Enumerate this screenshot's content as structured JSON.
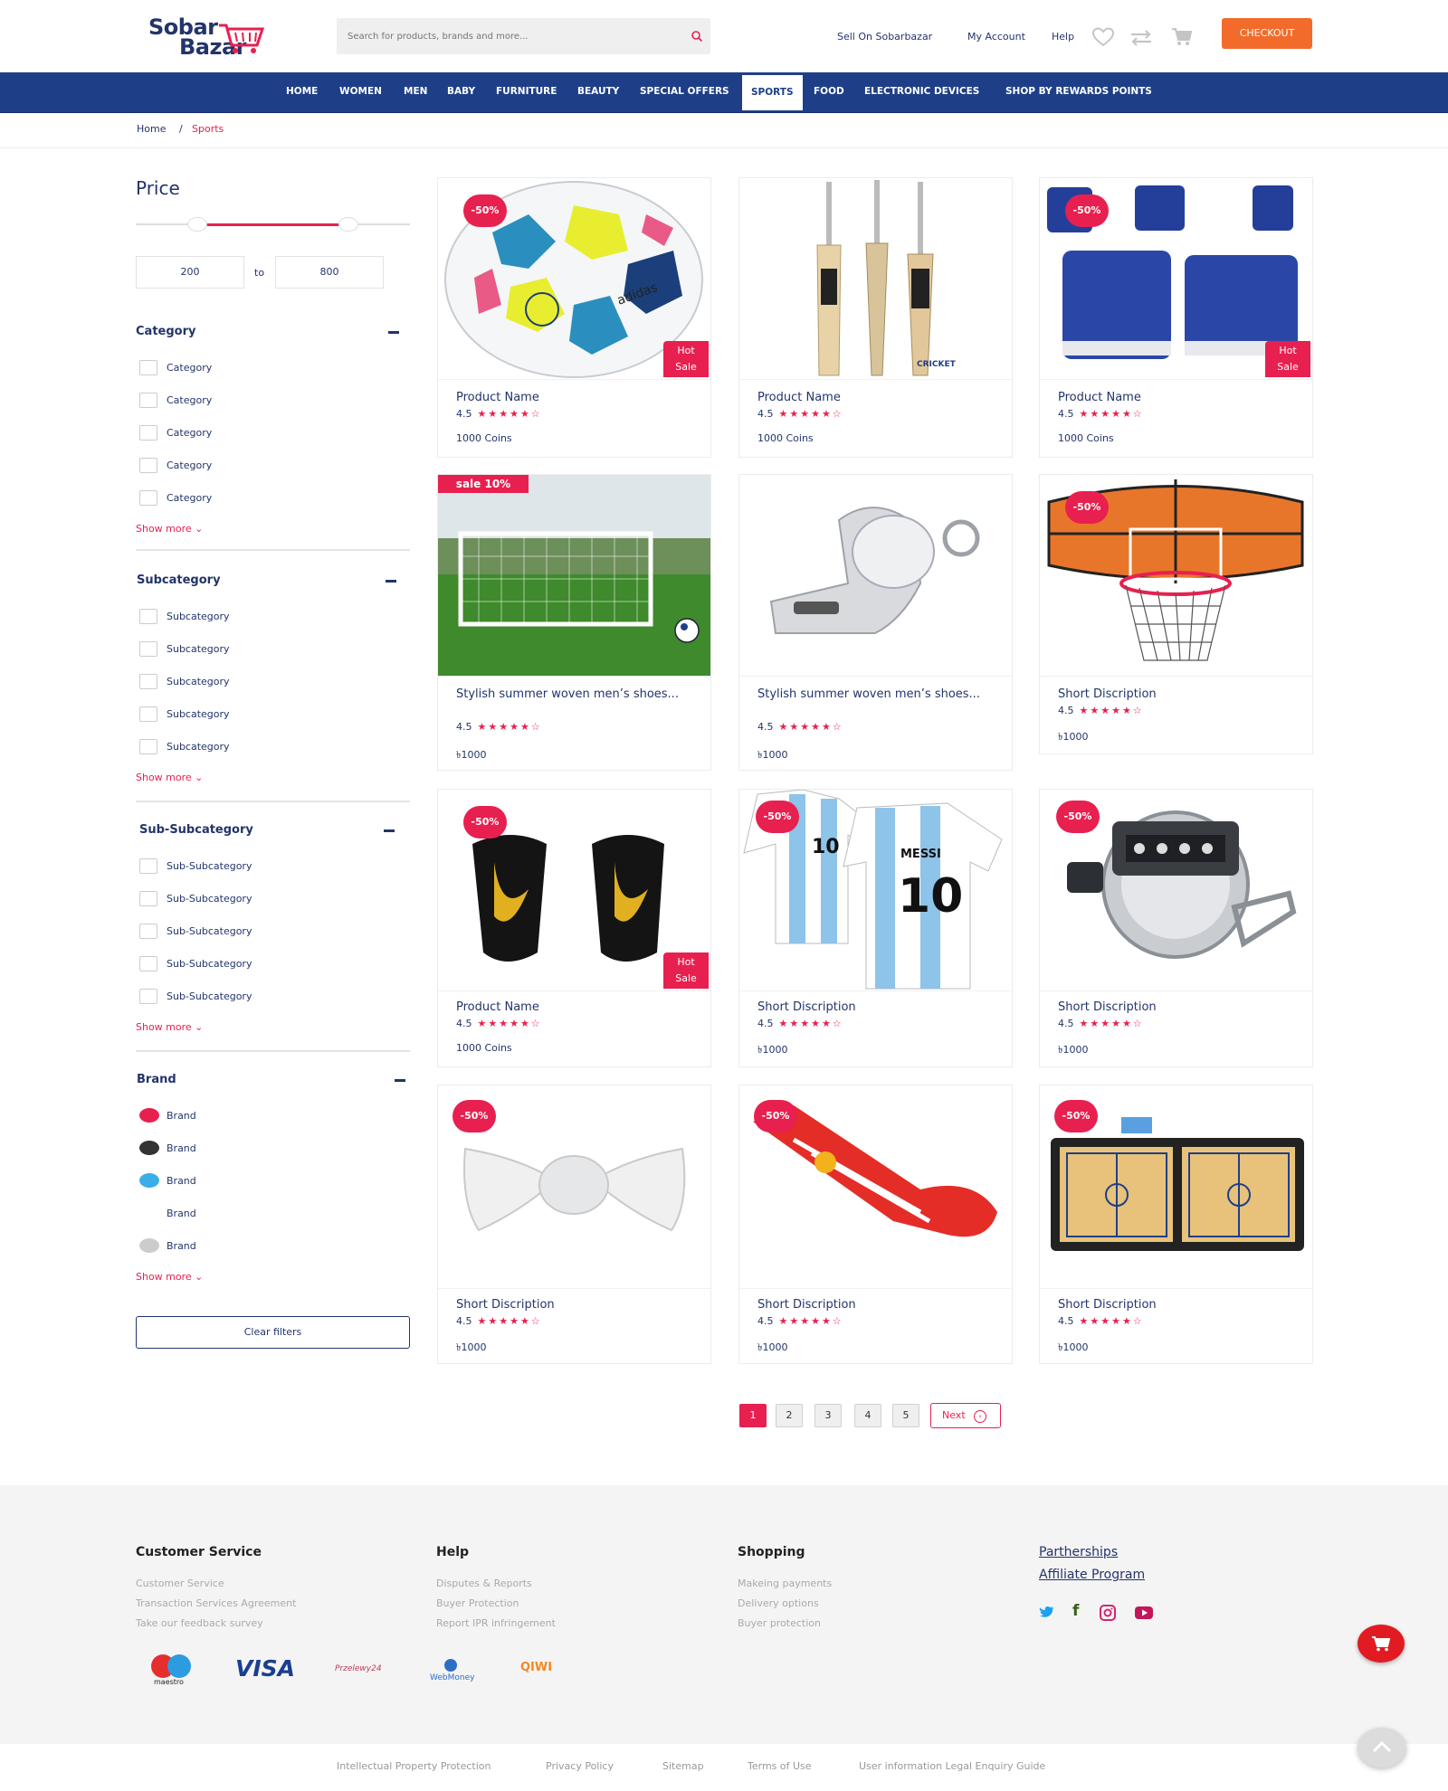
{
  "header": {
    "logo_line1": "Sobar",
    "logo_line2": "Bazar",
    "search_placeholder": "Search for products, brands and more...",
    "links": [
      "Sell On Sobarbazar",
      "My Account",
      "Help"
    ],
    "checkout_label": "CHECKOUT",
    "accent": "#f26b2b"
  },
  "nav": {
    "items": [
      "HOME",
      "WOMEN",
      "MEN",
      "BABY",
      "FURNITURE",
      "BEAUTY",
      "SPECIAL OFFERS",
      "SPORTS",
      "FOOD",
      "ELECTRONIC DEVICES",
      "SHOP BY REWARDS POINTS"
    ],
    "active": "SPORTS",
    "color": "#1e3f88"
  },
  "breadcrumb": {
    "home": "Home",
    "sep": "/",
    "current": "Sports"
  },
  "sidebar": {
    "price": {
      "title": "Price",
      "min": "200",
      "to": "to",
      "max": "800"
    },
    "category": {
      "title": "Category",
      "items": [
        "Category",
        "Category",
        "Category",
        "Category",
        "Category"
      ],
      "show_more": "Show more"
    },
    "subcategory": {
      "title": "Subcategory",
      "items": [
        "Subcategory",
        "Subcategory",
        "Subcategory",
        "Subcategory",
        "Subcategory"
      ],
      "show_more": "Show more"
    },
    "subsubcategory": {
      "title": "Sub-Subcategory",
      "items": [
        "Sub-Subcategory",
        "Sub-Subcategory",
        "Sub-Subcategory",
        "Sub-Subcategory",
        "Sub-Subcategory"
      ],
      "show_more": "Show more"
    },
    "brand": {
      "title": "Brand",
      "items": [
        {
          "label": "Brand",
          "color": "#e8204f"
        },
        {
          "label": "Brand",
          "color": "#333333"
        },
        {
          "label": "Brand",
          "color": "#3aaee8"
        },
        {
          "label": "Brand",
          "color": "#ffffff"
        },
        {
          "label": "Brand",
          "color": "#cccccc"
        }
      ],
      "show_more": "Show more"
    },
    "clear_filters": "Clear filters"
  },
  "products": [
    {
      "name": "Product Name",
      "rating": "4.5",
      "stars": "★★★★★☆",
      "price": "1000 Coins",
      "discount": "-50%",
      "hot": [
        "Hot",
        "Sale"
      ],
      "image": "soccer-ball"
    },
    {
      "name": "Product Name",
      "rating": "4.5",
      "stars": "★★★★★☆",
      "price": "1000 Coins",
      "image": "cricket-bats"
    },
    {
      "name": "Product Name",
      "rating": "4.5",
      "stars": "★★★★★☆",
      "price": "1000 Coins",
      "discount": "-50%",
      "hot": [
        "Hot",
        "Sale"
      ],
      "image": "ankle-supports"
    },
    {
      "name": "Stylish summer woven men’s shoes...",
      "rating": "4.5",
      "stars": "★★★★★☆",
      "price": "৳1000",
      "sale": "sale 10%",
      "image": "soccer-goal"
    },
    {
      "name": "Stylish summer woven men’s shoes...",
      "rating": "4.5",
      "stars": "★★★★★☆",
      "price": "৳1000",
      "image": "whistle"
    },
    {
      "name": "Short Discription",
      "rating": "4.5",
      "stars": "★★★★★☆",
      "price": "৳1000",
      "discount": "-50%",
      "image": "basketball-hoop"
    },
    {
      "name": "Product Name",
      "rating": "4.5",
      "stars": "★★★★★☆",
      "price": "1000 Coins",
      "discount": "-50%",
      "hot": [
        "Hot",
        "Sale"
      ],
      "image": "shin-guards"
    },
    {
      "name": "Short Discription",
      "rating": "4.5",
      "stars": "★★★★★☆",
      "price": "৳1000",
      "discount": "-50%",
      "image": "argentina-jersey"
    },
    {
      "name": "Short Discription",
      "rating": "4.5",
      "stars": "★★★★★☆",
      "price": "৳1000",
      "discount": "-50%",
      "image": "tally-counter"
    },
    {
      "name": "Short Discription",
      "rating": "4.5",
      "stars": "★★★★★☆",
      "price": "৳1000",
      "discount": "-50%",
      "image": "posture-brace"
    },
    {
      "name": "Short Discription",
      "rating": "4.5",
      "stars": "★★★★★☆",
      "price": "৳1000",
      "discount": "-50%",
      "image": "red-socks"
    },
    {
      "name": "Short Discription",
      "rating": "4.5",
      "stars": "★★★★★☆",
      "price": "৳1000",
      "discount": "-50%",
      "image": "tactics-board"
    }
  ],
  "jersey_text": {
    "number": "10",
    "name": "MESSI"
  },
  "pagination": {
    "pages": [
      "1",
      "2",
      "3",
      "4",
      "5"
    ],
    "active": "1",
    "next": "Next"
  },
  "footer": {
    "columns": [
      {
        "title": "Customer Service",
        "links": [
          "Customer Service",
          "Transaction Services Agreement",
          "Take our feedback survey"
        ]
      },
      {
        "title": "Help",
        "links": [
          "Disputes & Reports",
          "Buyer Protection",
          "Report IPR infringement"
        ]
      },
      {
        "title": "Shopping",
        "links": [
          "Makeing payments",
          "Delivery options",
          "Buyer protection"
        ]
      }
    ],
    "partners": [
      "Partherships",
      "Affiliate Program"
    ],
    "social_icons": [
      "twitter-icon",
      "facebook-icon",
      "instagram-icon",
      "youtube-icon"
    ],
    "payments": [
      "maestro",
      "VISA",
      "Przelewy24",
      "WebMoney",
      "QIWI"
    ],
    "bottom_links": [
      "Intellectual Property Protection",
      "Privacy Policy",
      "Sitemap",
      "Terms of Use",
      "User information Legal Enquiry Guide"
    ]
  }
}
